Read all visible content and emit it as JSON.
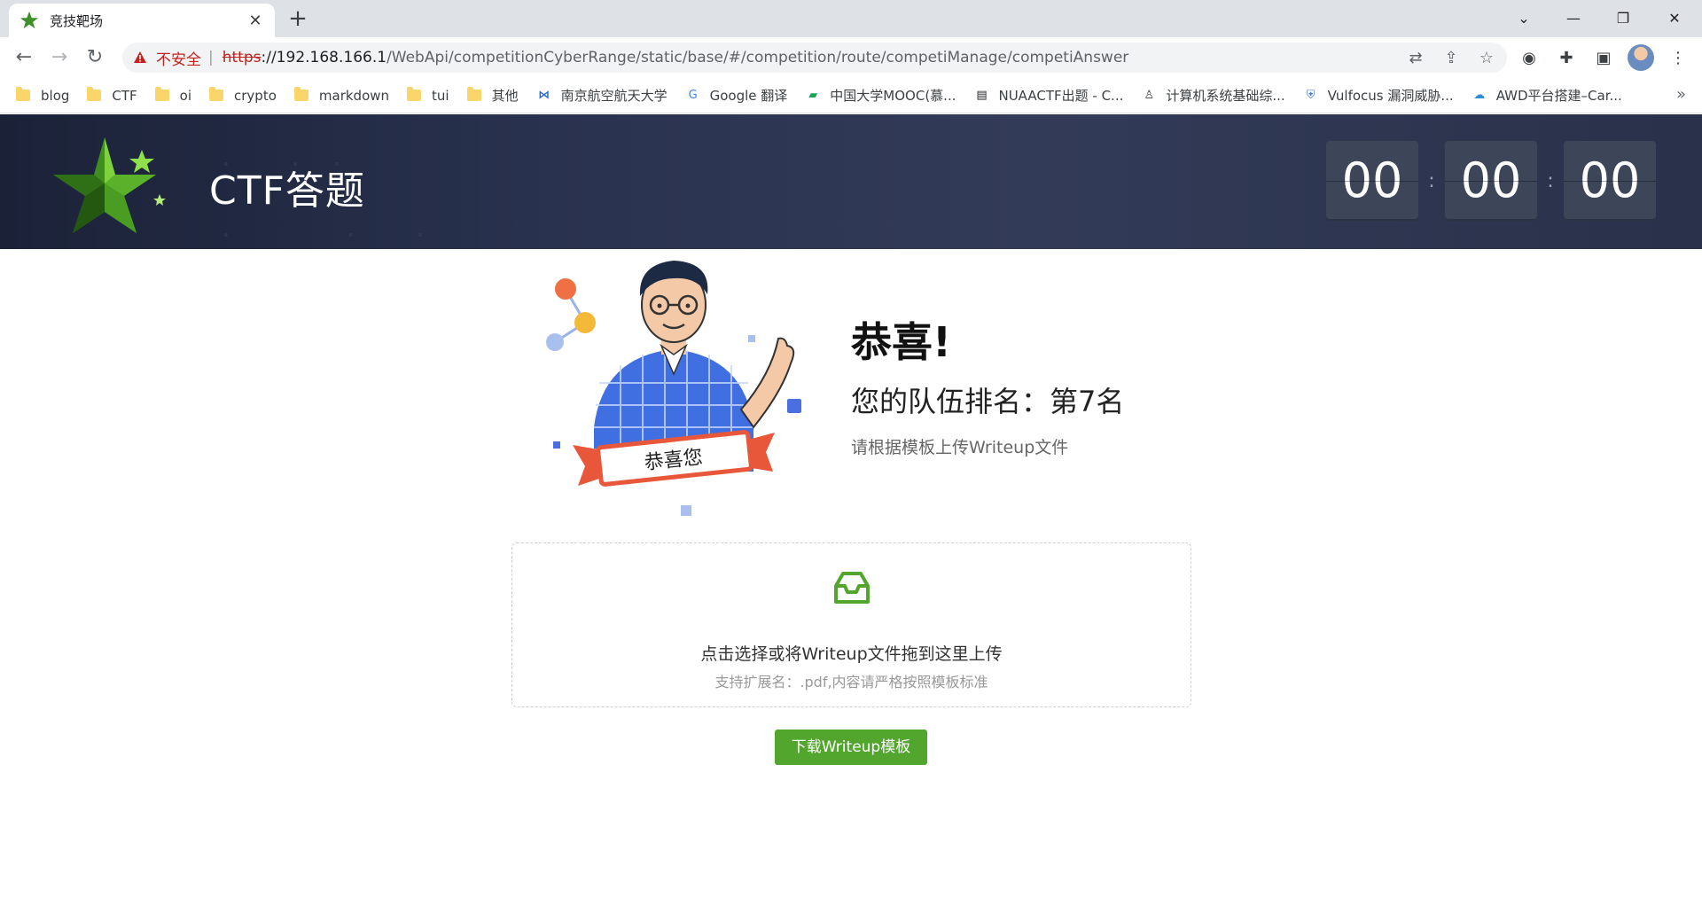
{
  "browser": {
    "tab_title": "竞技靶场",
    "tab_close": "✕",
    "new_tab": "+",
    "security_label": "不安全",
    "separator": "|",
    "url_scheme": "https",
    "url_host": "://192.168.166.1",
    "url_path": "/WebApi/competitionCyberRange/static/base/#/competition/route/competiManage/competiAnswer",
    "bookmarks": [
      {
        "label": "blog",
        "icon": "folder-icon"
      },
      {
        "label": "CTF",
        "icon": "folder-icon"
      },
      {
        "label": "oi",
        "icon": "folder-icon"
      },
      {
        "label": "crypto",
        "icon": "folder-icon"
      },
      {
        "label": "markdown",
        "icon": "folder-icon"
      },
      {
        "label": "tui",
        "icon": "folder-icon"
      },
      {
        "label": "其他",
        "icon": "folder-icon"
      },
      {
        "label": "南京航空航天大学",
        "icon": "nuaa-icon"
      },
      {
        "label": "Google 翻译",
        "icon": "translate-icon"
      },
      {
        "label": "中国大学MOOC(慕...",
        "icon": "mooc-icon"
      },
      {
        "label": "NUAACTF出题 - C...",
        "icon": "document-icon"
      },
      {
        "label": "计算机系统基础综...",
        "icon": "person-icon"
      },
      {
        "label": "Vulfocus 漏洞威胁...",
        "icon": "shield-icon"
      },
      {
        "label": "AWD平台搭建–Car...",
        "icon": "cloud-icon"
      }
    ],
    "bookmarks_more": "»"
  },
  "header": {
    "title": "CTF答题",
    "timer": {
      "hours": "00",
      "minutes": "00",
      "seconds": "00",
      "colon": ":"
    }
  },
  "result": {
    "illustration_text": "恭喜您",
    "congrats": "恭喜!",
    "rank": "您的队伍排名：第7名",
    "hint": "请根据模板上传Writeup文件"
  },
  "upload": {
    "text": "点击选择或将Writeup文件拖到这里上传",
    "subtext": "支持扩展名：.pdf,内容请严格按照模板标准"
  },
  "download_button": "下载Writeup模板",
  "colors": {
    "accent_green": "#52a62d",
    "header_bg": "#2a3350",
    "insecure_red": "#c5221f"
  }
}
